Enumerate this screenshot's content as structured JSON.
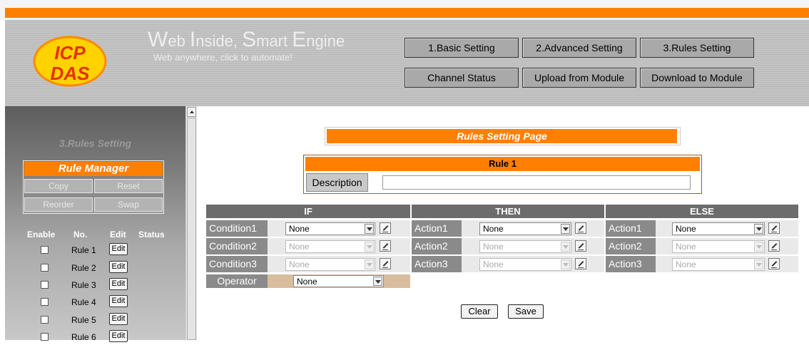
{
  "brand": {
    "logo_text_top": "ICP",
    "logo_text_bottom": "DAS",
    "tagline_parts": [
      "W",
      "eb ",
      "I",
      "nside, ",
      "S",
      "mart ",
      "E",
      "ngine"
    ],
    "subtagline": "Web anywhere, click to automate!"
  },
  "nav": {
    "basic": "1.Basic Setting",
    "advanced": "2.Advanced Setting",
    "rules": "3.Rules Setting",
    "channel_status": "Channel Status",
    "upload": "Upload from Module",
    "download": "Download to Module"
  },
  "sidebar": {
    "title": "3.Rules Setting",
    "rule_manager": "Rule Manager",
    "copy": "Copy",
    "reset": "Reset",
    "reorder": "Reorder",
    "swap": "Swap",
    "col_enable": "Enable",
    "col_no": "No.",
    "col_edit": "Edit",
    "col_status": "Status",
    "edit_label": "Edit",
    "rules": [
      "Rule 1",
      "Rule 2",
      "Rule 3",
      "Rule 4",
      "Rule 5",
      "Rule 6"
    ]
  },
  "main": {
    "page_title": "Rules Setting Page",
    "rule_title": "Rule 1",
    "description_label": "Description",
    "description_value": "",
    "if_header": "IF",
    "then_header": "THEN",
    "else_header": "ELSE",
    "conditions": [
      {
        "label": "Condition1",
        "value": "None"
      },
      {
        "label": "Condition2",
        "value": "None"
      },
      {
        "label": "Condition3",
        "value": "None"
      }
    ],
    "then_actions": [
      {
        "label": "Action1",
        "value": "None"
      },
      {
        "label": "Action2",
        "value": "None"
      },
      {
        "label": "Action3",
        "value": "None"
      }
    ],
    "else_actions": [
      {
        "label": "Action1",
        "value": "None"
      },
      {
        "label": "Action2",
        "value": "None"
      },
      {
        "label": "Action3",
        "value": "None"
      }
    ],
    "operator_label": "Operator",
    "operator_value": "None",
    "clear": "Clear",
    "save": "Save"
  },
  "colors": {
    "accent": "#ff8000",
    "header_bg": "#c4c4c4",
    "table_header": "#6c6c6c",
    "row_label": "#8a8a8a",
    "operator_cell": "#d8bd9e"
  },
  "icons": {
    "edit_pencil": "edit-pencil-icon",
    "dropdown": "chevron-down-icon"
  }
}
